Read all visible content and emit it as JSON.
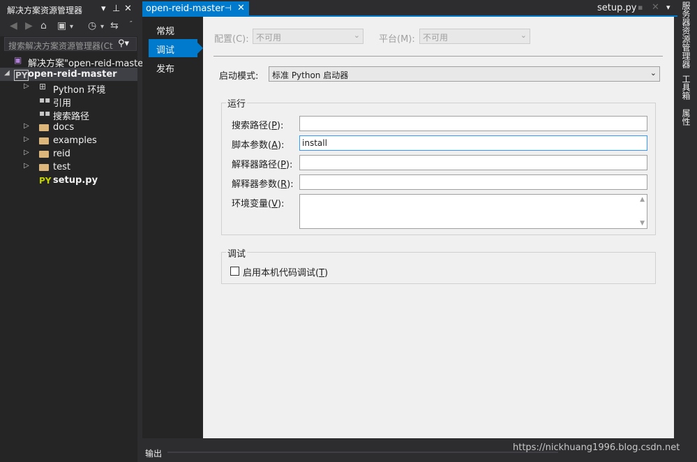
{
  "solution_explorer": {
    "title": "解决方案资源管理器",
    "search_placeholder": "搜索解决方案资源管理器(Ct",
    "tree": [
      {
        "label": "解决方案\"open-reid-master",
        "level": 0,
        "icon": "solution-icon"
      },
      {
        "label": "open-reid-master",
        "level": 0,
        "icon": "python-project-icon",
        "bold": true,
        "expanded": true,
        "selected": true
      },
      {
        "label": "Python 环境",
        "level": 1,
        "icon": "python-env-icon",
        "collapsed": true
      },
      {
        "label": "引用",
        "level": 1,
        "icon": "references-icon"
      },
      {
        "label": "搜索路径",
        "level": 1,
        "icon": "search-path-icon"
      },
      {
        "label": "docs",
        "level": 1,
        "icon": "folder-icon",
        "collapsed": true
      },
      {
        "label": "examples",
        "level": 1,
        "icon": "folder-icon",
        "collapsed": true
      },
      {
        "label": "reid",
        "level": 1,
        "icon": "folder-icon",
        "collapsed": true
      },
      {
        "label": "test",
        "level": 1,
        "icon": "folder-icon",
        "collapsed": true
      },
      {
        "label": "setup.py",
        "level": 1,
        "icon": "python-file-icon",
        "bold": true
      }
    ]
  },
  "tabs": {
    "active": "open-reid-master",
    "secondary": "setup.py"
  },
  "nav": {
    "items": [
      "常规",
      "调试",
      "发布"
    ],
    "active_index": 1
  },
  "config_row": {
    "config_label": "配置(C):",
    "config_value": "不可用",
    "platform_label": "平台(M):",
    "platform_value": "不可用"
  },
  "launch": {
    "label": "启动模式:",
    "value": "标准 Python 启动器"
  },
  "run_group": {
    "title": "运行",
    "fields": [
      {
        "label": "搜索路径",
        "key": "P",
        "value": ""
      },
      {
        "label": "脚本参数",
        "key": "A",
        "value": "install"
      },
      {
        "label": "解释器路径",
        "key": "P",
        "value": ""
      },
      {
        "label": "解释器参数",
        "key": "R",
        "value": ""
      },
      {
        "label": "环境变量",
        "key": "V",
        "value": ""
      }
    ]
  },
  "debug_group": {
    "title": "调试",
    "checkbox_label": "启用本机代码调试",
    "checkbox_key": "T",
    "checked": false
  },
  "right_tabs": [
    "服务器资源管理器",
    "工具箱",
    "属性"
  ],
  "output": {
    "label": "输出"
  },
  "watermark": "https://nickhuang1996.blog.csdn.net",
  "colors": {
    "accent": "#007acc",
    "folder": "#dcb67a",
    "page_bg": "#f0f0f0"
  }
}
